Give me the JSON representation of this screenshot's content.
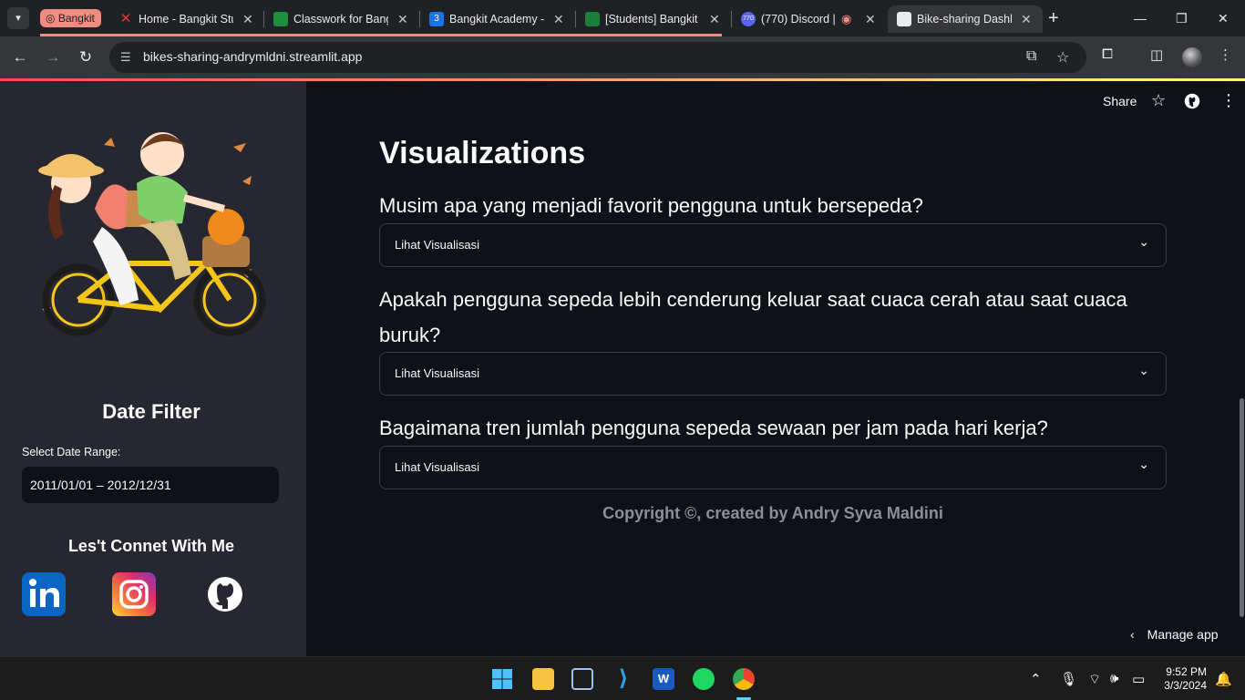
{
  "browser": {
    "tab_group": "Bangkit",
    "tabs": [
      {
        "title": "Home - Bangkit Stu",
        "favicon": "bangkit-icon",
        "color": "#e53935"
      },
      {
        "title": "Classwork for Bang",
        "favicon": "classroom-icon",
        "color": "#1e8e3e"
      },
      {
        "title": "Bangkit Academy -",
        "favicon": "calendar-icon",
        "color": "#1a73e8"
      },
      {
        "title": "[Students] Bangkit",
        "favicon": "sheets-icon",
        "color": "#188038"
      },
      {
        "title": "(770) Discord |",
        "favicon": "discord-icon",
        "color": "#5865f2",
        "badge": "770"
      },
      {
        "title": "Bike-sharing Dashb",
        "favicon": "streamlit-icon",
        "color": "#ff4b4b",
        "active": true
      }
    ],
    "url": "bikes-sharing-andrymldni.streamlit.app"
  },
  "sidebar": {
    "date_filter_title": "Date Filter",
    "date_range_label": "Select Date Range:",
    "date_range_value": "2011/01/01 – 2012/12/31",
    "connect_title": "Les't Connet With Me",
    "socials": [
      "linkedin-icon",
      "instagram-icon",
      "github-icon"
    ]
  },
  "main": {
    "share_label": "Share",
    "title": "Visualizations",
    "sections": [
      {
        "question": "Musim apa yang menjadi favorit pengguna untuk bersepeda?",
        "expander": "Lihat Visualisasi"
      },
      {
        "question": "Apakah pengguna sepeda lebih cenderung keluar saat cuaca cerah atau saat cuaca buruk?",
        "expander": "Lihat Visualisasi"
      },
      {
        "question": "Bagaimana tren jumlah pengguna sepeda sewaan per jam pada hari kerja?",
        "expander": "Lihat Visualisasi"
      }
    ],
    "copyright": "Copyright ©, created by Andry Syva Maldini",
    "manage_app": "Manage app"
  },
  "taskbar": {
    "apps": [
      "windows-start-icon",
      "file-explorer-icon",
      "virtualbox-icon",
      "vscode-icon",
      "word-icon",
      "spotify-icon",
      "chrome-icon"
    ],
    "time": "9:52 PM",
    "date": "3/3/2024"
  },
  "colors": {
    "accent": "#ff4b4b",
    "background": "#0e1117",
    "sidebar": "#262730"
  }
}
